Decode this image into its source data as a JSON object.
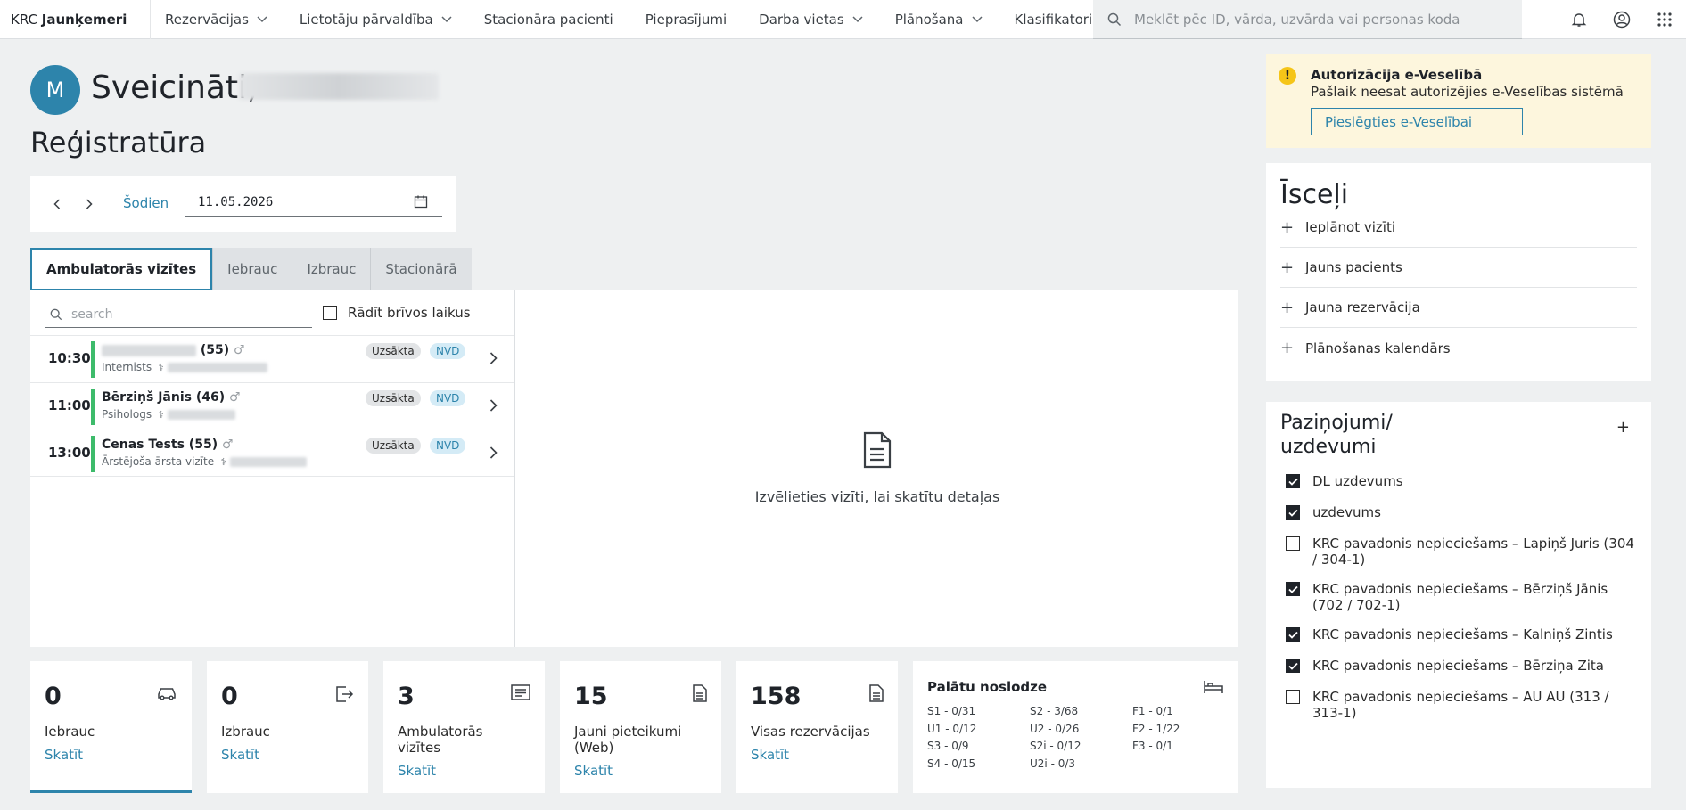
{
  "app": {
    "brand_prefix": "KRC",
    "brand_name": "Jaunķemeri"
  },
  "nav": {
    "items": [
      {
        "label": "Rezervācijas",
        "has_dropdown": true
      },
      {
        "label": "Lietotāju pārvaldība",
        "has_dropdown": true
      },
      {
        "label": "Stacionāra pacienti",
        "has_dropdown": false
      },
      {
        "label": "Pieprasījumi",
        "has_dropdown": false
      },
      {
        "label": "Darba vietas",
        "has_dropdown": true
      },
      {
        "label": "Plānošana",
        "has_dropdown": true
      },
      {
        "label": "Klasifikatori",
        "has_dropdown": false
      }
    ],
    "search_placeholder": "Meklēt pēc ID, vārda, uzvārda vai personas koda",
    "icons": [
      "bell-icon",
      "user-icon",
      "apps-grid-icon"
    ]
  },
  "greeting": {
    "avatar_initial": "M",
    "text": "Sveicināti,"
  },
  "page_title": "Reģistratūra",
  "date_panel": {
    "today_label": "Šodien",
    "date_value": "11.05.2026"
  },
  "tabs": [
    {
      "label": "Ambulatorās vizītes",
      "active": true
    },
    {
      "label": "Iebrauc",
      "active": false
    },
    {
      "label": "Izbrauc",
      "active": false
    },
    {
      "label": "Stacionārā",
      "active": false
    }
  ],
  "visits": {
    "search_placeholder": "search",
    "show_free_label": "Rādīt brīvos laikus",
    "rows": [
      {
        "time": "10:30",
        "name": "(55)",
        "role": "Internists",
        "status": "Uzsākta",
        "payer": "NVD"
      },
      {
        "time": "11:00",
        "name": "Bērziņš Jānis (46)",
        "role": "Psihologs",
        "status": "Uzsākta",
        "payer": "NVD"
      },
      {
        "time": "13:00",
        "name": "Cenas Tests (55)",
        "role": "Ārstējoša ārsta vizīte",
        "status": "Uzsākta",
        "payer": "NVD"
      }
    ]
  },
  "details": {
    "hint": "Izvēlieties vizīti, lai skatītu detaļas"
  },
  "stats": [
    {
      "value": "0",
      "label": "Iebrauc",
      "link": "Skatīt",
      "icon": "car-icon"
    },
    {
      "value": "0",
      "label": "Izbrauc",
      "link": "Skatīt",
      "icon": "exit-icon"
    },
    {
      "value": "3",
      "label": "Ambulatorās vizītes",
      "link": "Skatīt",
      "icon": "list-icon"
    },
    {
      "value": "15",
      "label": "Jauni pieteikumi (Web)",
      "link": "Skatīt",
      "icon": "document-icon"
    },
    {
      "value": "158",
      "label": "Visas rezervācijas",
      "link": "Skatīt",
      "icon": "document-icon"
    }
  ],
  "occupancy": {
    "title": "Palātu noslodze",
    "cells": [
      "S1 - 0/31",
      "S2 - 3/68",
      "F1 - 0/1",
      "U1 - 0/12",
      "U2 - 0/26",
      "F2 - 1/22",
      "S3 - 0/9",
      "S2i - 0/12",
      "F3 - 0/1",
      "S4 - 0/15",
      "U2i - 0/3",
      ""
    ]
  },
  "auth": {
    "title": "Autorizācija e-Veselībā",
    "text": "Pašlaik neesat autorizējies e-Veselības sistēmā",
    "button": "Pieslēgties e-Veselībai"
  },
  "shortcuts": {
    "title": "Īsceļi",
    "items": [
      "Ieplānot vizīti",
      "Jauns pacients",
      "Jauna rezervācija",
      "Plānošanas kalendārs"
    ]
  },
  "notifications": {
    "title_line1": "Paziņojumi/",
    "title_line2": "uzdevumi",
    "add_label": "+",
    "items": [
      {
        "text": "DL uzdevums",
        "checked": true
      },
      {
        "text": "uzdevums",
        "checked": true
      },
      {
        "text": "KRC pavadonis nepieciešams – Lapiņš Juris (304 / 304-1)",
        "checked": false
      },
      {
        "text": "KRC pavadonis nepieciešams – Bērziņš Jānis (702 / 702-1)",
        "checked": true
      },
      {
        "text": "KRC pavadonis nepieciešams – Kalniņš Zintis",
        "checked": true
      },
      {
        "text": "KRC pavadonis nepieciešams – Bērziņa Zita",
        "checked": true
      },
      {
        "text": "KRC pavadonis nepieciešams – AU AU (313 / 313-1)",
        "checked": false
      }
    ]
  },
  "colors": {
    "accent": "#2d84ab",
    "status_green": "#3dbb6b",
    "warning": "#f5c518"
  }
}
